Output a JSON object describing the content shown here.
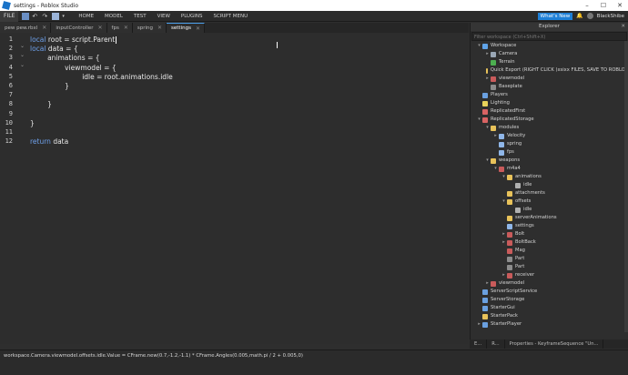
{
  "window": {
    "title": "settings - Roblox Studio"
  },
  "menubar": {
    "file": "FILE",
    "items": [
      "HOME",
      "MODEL",
      "TEST",
      "VIEW",
      "PLUGINS",
      "SCRIPT MENU"
    ],
    "whats_new": "What's New",
    "user": "BlackShibe"
  },
  "tabs": [
    {
      "label": "pew pew.rbxl",
      "active": false
    },
    {
      "label": "inputController",
      "active": false
    },
    {
      "label": "fps",
      "active": false
    },
    {
      "label": "spring",
      "active": false
    },
    {
      "label": "settings",
      "active": true
    }
  ],
  "editor": {
    "line_numbers": [
      "1",
      "2",
      "3",
      "4",
      "5",
      "6",
      "7",
      "8",
      "9",
      "10",
      "11",
      "12"
    ],
    "lines": [
      {
        "kw": "local",
        "text": " root = script.Parent"
      },
      {
        "kw": "local",
        "text": " data = {"
      },
      {
        "kw": "",
        "text": "        animations = {"
      },
      {
        "kw": "",
        "text": "                viewmodel = {"
      },
      {
        "kw": "",
        "text": "                        idle = root.animations.idle"
      },
      {
        "kw": "",
        "text": "                }"
      },
      {
        "kw": "",
        "text": ""
      },
      {
        "kw": "",
        "text": "        }"
      },
      {
        "kw": "",
        "text": ""
      },
      {
        "kw": "",
        "text": "}"
      },
      {
        "kw": "",
        "text": ""
      },
      {
        "kw": "return",
        "text": " data"
      }
    ]
  },
  "explorer": {
    "title": "Explorer",
    "filter_placeholder": "Filter workspace (Ctrl+Shift+X)",
    "items": [
      {
        "label": "Workspace",
        "depth": 0,
        "arrow": "open",
        "icon": "workspace-icon",
        "color": "#5fa3e8"
      },
      {
        "label": "Camera",
        "depth": 1,
        "arrow": "closed",
        "icon": "camera-icon",
        "color": "#9aa7b5"
      },
      {
        "label": "Terrain",
        "depth": 1,
        "arrow": "none",
        "icon": "terrain-icon",
        "color": "#4caf50"
      },
      {
        "label": "Quick Export (RIGHT CLICK )xsixx FILES, SAVE TO ROBLOX",
        "depth": 1,
        "arrow": "none",
        "icon": "folder-icon",
        "color": "#e8c25a"
      },
      {
        "label": "viewmodel",
        "depth": 1,
        "arrow": "closed",
        "icon": "model-icon",
        "color": "#c95b5b"
      },
      {
        "label": "Baseplate",
        "depth": 1,
        "arrow": "none",
        "icon": "part-icon",
        "color": "#8c8c8c"
      },
      {
        "label": "Players",
        "depth": 0,
        "arrow": "none",
        "icon": "players-icon",
        "color": "#6aa0e0"
      },
      {
        "label": "Lighting",
        "depth": 0,
        "arrow": "none",
        "icon": "lighting-icon",
        "color": "#e8d25a"
      },
      {
        "label": "ReplicatedFirst",
        "depth": 0,
        "arrow": "none",
        "icon": "replicated-first-icon",
        "color": "#d96363"
      },
      {
        "label": "ReplicatedStorage",
        "depth": 0,
        "arrow": "open",
        "icon": "replicated-storage-icon",
        "color": "#d96363"
      },
      {
        "label": "modules",
        "depth": 1,
        "arrow": "open",
        "icon": "folder-icon",
        "color": "#e8c25a"
      },
      {
        "label": "Velocity",
        "depth": 2,
        "arrow": "closed",
        "icon": "module-script-icon",
        "color": "#8fb6e8"
      },
      {
        "label": "spring",
        "depth": 2,
        "arrow": "none",
        "icon": "module-script-icon",
        "color": "#8fb6e8"
      },
      {
        "label": "fps",
        "depth": 2,
        "arrow": "none",
        "icon": "module-script-icon",
        "color": "#8fb6e8"
      },
      {
        "label": "weapons",
        "depth": 1,
        "arrow": "open",
        "icon": "folder-icon",
        "color": "#e8c25a"
      },
      {
        "label": "m4a4",
        "depth": 2,
        "arrow": "open",
        "icon": "model-icon",
        "color": "#c95b5b"
      },
      {
        "label": "animations",
        "depth": 3,
        "arrow": "open",
        "icon": "folder-icon",
        "color": "#e8c25a"
      },
      {
        "label": "idle",
        "depth": 4,
        "arrow": "none",
        "icon": "animation-icon",
        "color": "#b0b0b0"
      },
      {
        "label": "attachments",
        "depth": 3,
        "arrow": "none",
        "icon": "folder-icon",
        "color": "#e8c25a"
      },
      {
        "label": "offsets",
        "depth": 3,
        "arrow": "open",
        "icon": "folder-icon",
        "color": "#e8c25a"
      },
      {
        "label": "idle",
        "depth": 4,
        "arrow": "none",
        "icon": "cframe-value-icon",
        "color": "#b0b0b0"
      },
      {
        "label": "serverAnimations",
        "depth": 3,
        "arrow": "none",
        "icon": "folder-icon",
        "color": "#e8c25a"
      },
      {
        "label": "settings",
        "depth": 3,
        "arrow": "none",
        "icon": "module-script-icon",
        "color": "#8fb6e8"
      },
      {
        "label": "Bolt",
        "depth": 3,
        "arrow": "closed",
        "icon": "union-icon",
        "color": "#c95b5b"
      },
      {
        "label": "BoltBack",
        "depth": 3,
        "arrow": "closed",
        "icon": "union-icon",
        "color": "#c95b5b"
      },
      {
        "label": "Mag",
        "depth": 3,
        "arrow": "none",
        "icon": "union-icon",
        "color": "#c95b5b"
      },
      {
        "label": "Part",
        "depth": 3,
        "arrow": "none",
        "icon": "part-icon",
        "color": "#8c8c8c"
      },
      {
        "label": "Part",
        "depth": 3,
        "arrow": "none",
        "icon": "part-icon",
        "color": "#8c8c8c"
      },
      {
        "label": "receiver",
        "depth": 3,
        "arrow": "closed",
        "icon": "union-icon",
        "color": "#c95b5b"
      },
      {
        "label": "viewmodel",
        "depth": 1,
        "arrow": "closed",
        "icon": "model-icon",
        "color": "#c95b5b"
      },
      {
        "label": "ServerScriptService",
        "depth": 0,
        "arrow": "none",
        "icon": "server-script-service-icon",
        "color": "#6aa0e0"
      },
      {
        "label": "ServerStorage",
        "depth": 0,
        "arrow": "none",
        "icon": "server-storage-icon",
        "color": "#6aa0e0"
      },
      {
        "label": "StarterGui",
        "depth": 0,
        "arrow": "none",
        "icon": "starter-gui-icon",
        "color": "#6aa0e0"
      },
      {
        "label": "StarterPack",
        "depth": 0,
        "arrow": "none",
        "icon": "starter-pack-icon",
        "color": "#e8c25a"
      },
      {
        "label": "StarterPlayer",
        "depth": 0,
        "arrow": "closed",
        "icon": "starter-player-icon",
        "color": "#6aa0e0"
      }
    ]
  },
  "bottom_tabs": [
    "E...",
    "R...",
    "Properties - KeyframeSequence \"Un..."
  ],
  "command_bar": {
    "text": "workspace.Camera.viewmodel.offsets.idle.Value = CFrame.new(0.7,-1.2,-1.1) * CFrame.Angles(0.005,math.pi / 2 + 0.005,0)"
  },
  "colors": {
    "keyword": "#6ea0ea",
    "accent": "#1e7fd6"
  }
}
